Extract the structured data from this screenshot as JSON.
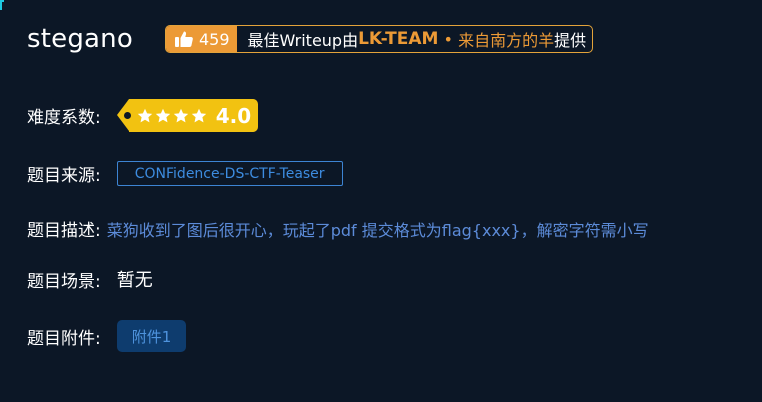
{
  "challenge": {
    "title": "stegano"
  },
  "writeup": {
    "likes": "459",
    "prefix": "最佳Writeup由",
    "team": "LK-TEAM",
    "separator": " • ",
    "author": "来自南方的羊",
    "suffix": "提供",
    "icon": "thumbs-up-icon"
  },
  "difficulty": {
    "label": "难度系数:",
    "rating": "4.0",
    "stars": 4,
    "icon": "star-icon"
  },
  "source": {
    "label": "题目来源:",
    "value": "CONFidence-DS-CTF-Teaser"
  },
  "description": {
    "label": "题目描述:",
    "value": "菜狗收到了图后很开心，玩起了pdf 提交格式为flag{xxx}，解密字符需小写"
  },
  "scene": {
    "label": "题目场景:",
    "value": "暂无"
  },
  "attachment": {
    "label": "题目附件:",
    "button": "附件1"
  },
  "colors": {
    "background": "#0c1726",
    "orange": "#ec9a36",
    "gold": "#f2c211",
    "blue_text": "#5c8bd8",
    "source_border": "#3d84d3",
    "attachment_bg": "#0e3c6e"
  }
}
